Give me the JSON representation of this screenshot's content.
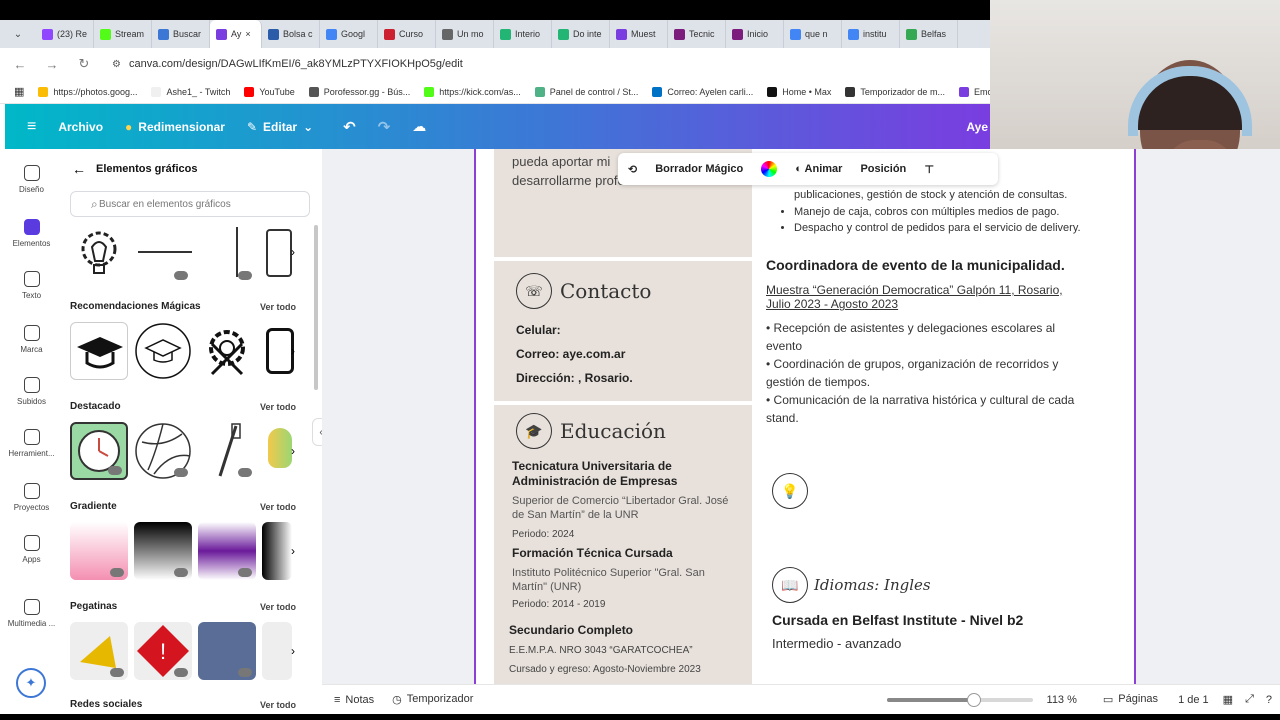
{
  "browser": {
    "tabs": [
      {
        "label": "(23) Re",
        "color": "#9146ff"
      },
      {
        "label": "Stream",
        "color": "#53fc18"
      },
      {
        "label": "Buscar",
        "color": "#3d77d6"
      },
      {
        "label": "Ay",
        "color": "#7a3de0",
        "active": true
      },
      {
        "label": "Bolsa c",
        "color": "#2a5caa"
      },
      {
        "label": "Googl",
        "color": "#4285f4"
      },
      {
        "label": "Curso",
        "color": "#cc1f2f"
      },
      {
        "label": "Un mo",
        "color": "#666666"
      },
      {
        "label": "Interio",
        "color": "#22b573"
      },
      {
        "label": "Do inte",
        "color": "#22b573"
      },
      {
        "label": "Muest",
        "color": "#7a3de0"
      },
      {
        "label": "Tecnic",
        "color": "#7c1c7c"
      },
      {
        "label": "Inicio",
        "color": "#7c1c7c"
      },
      {
        "label": "que n",
        "color": "#4285f4"
      },
      {
        "label": "institu",
        "color": "#4285f4"
      },
      {
        "label": "Belfas",
        "color": "#34a853"
      }
    ],
    "url": "canva.com/design/DAGwLIfKmEI/6_ak8YMLzPTYXFIOKHpO5g/edit",
    "bookmarks": [
      "https://photos.goog...",
      "Ashe1_ - Twitch",
      "YouTube",
      "Porofessor.gg - Bús...",
      "https://kick.com/as...",
      "Panel de control / St...",
      "Correo: Ayelen carli...",
      "Home • Max",
      "Temporizador de m...",
      "Emote"
    ]
  },
  "header": {
    "archivo": "Archivo",
    "redimensionar": "Redimensionar",
    "editar": "Editar",
    "user_short": "Aye"
  },
  "rail": [
    {
      "label": "Diseño"
    },
    {
      "label": "Elementos"
    },
    {
      "label": "Texto"
    },
    {
      "label": "Marca"
    },
    {
      "label": "Subidos"
    },
    {
      "label": "Herramient..."
    },
    {
      "label": "Proyectos"
    },
    {
      "label": "Apps"
    },
    {
      "label": "Multimedia ..."
    }
  ],
  "panel": {
    "title": "Elementos gráficos",
    "search_placeholder": "Buscar en elementos gráficos",
    "sections": [
      {
        "title": "Recomendaciones Mágicas",
        "see_all": "Ver todo"
      },
      {
        "title": "Destacado",
        "see_all": "Ver todo"
      },
      {
        "title": "Gradiente",
        "see_all": "Ver todo"
      },
      {
        "title": "Pegatinas",
        "see_all": "Ver todo"
      },
      {
        "title": "Redes sociales",
        "see_all": "Ver todo"
      }
    ]
  },
  "toolbar": {
    "borrador": "Borrador Mágico",
    "animar": "Animar",
    "posicion": "Posición"
  },
  "resume": {
    "intro_line1": "pueda aportar mi",
    "intro_line2": "desarrollarme profesionalmente.",
    "contact_title": "Contacto",
    "celular": "Celular:",
    "correo": "Correo: aye.com.ar",
    "direccion": "Dirección: , Rosario.",
    "education_title": "Educación",
    "edu1_title": "Tecnicatura Universitaria de Administración de Empresas",
    "edu1_school": "Superior de Comercio “Libertador Gral. José de San Martín” de la UNR",
    "edu1_period": "Periodo: 2024",
    "edu2_title": "Formación Técnica Cursada",
    "edu2_school": "Instituto Politécnico Superior \"Gral. San Martín\" (UNR)",
    "edu2_period": "Periodo: 2014 - 2019",
    "edu3_title": "Secundario Completo",
    "edu3_school": "E.E.M.P.A. NRO 3043 “GARATCOCHEA”",
    "edu3_period": "Cursado y egreso: Agosto-Noviembre 2023",
    "right_partial": "publicaciones, gestión de stock y atención de consultas.",
    "right_b1": "Manejo de caja, cobros con múltiples medios de pago.",
    "right_b2": "Despacho y control de pedidos para el servicio de delivery.",
    "job_title": "Coordinadora de evento de la municipalidad.",
    "job_place": "Muestra “Generación Democratica” Galpón 11, Rosario, Julio 2023 - Agosto 2023",
    "job_d1": "• Recepción de asistentes y delegaciones escolares al evento",
    "job_d2": "• Coordinación de grupos, organización de recorridos y gestión de tiempos.",
    "job_d3": "• Comunicación de la narrativa histórica y cultural de cada stand.",
    "lang_title": "Idiomas: Ingles",
    "lang_course": "Cursada en Belfast Institute - Nivel b2",
    "lang_level": "Intermedio - avanzado"
  },
  "footer": {
    "notas": "Notas",
    "temporizador": "Temporizador",
    "zoom": "113 %",
    "zoom_value": 0.6,
    "paginas": "Páginas",
    "page_count": "1 de 1"
  }
}
